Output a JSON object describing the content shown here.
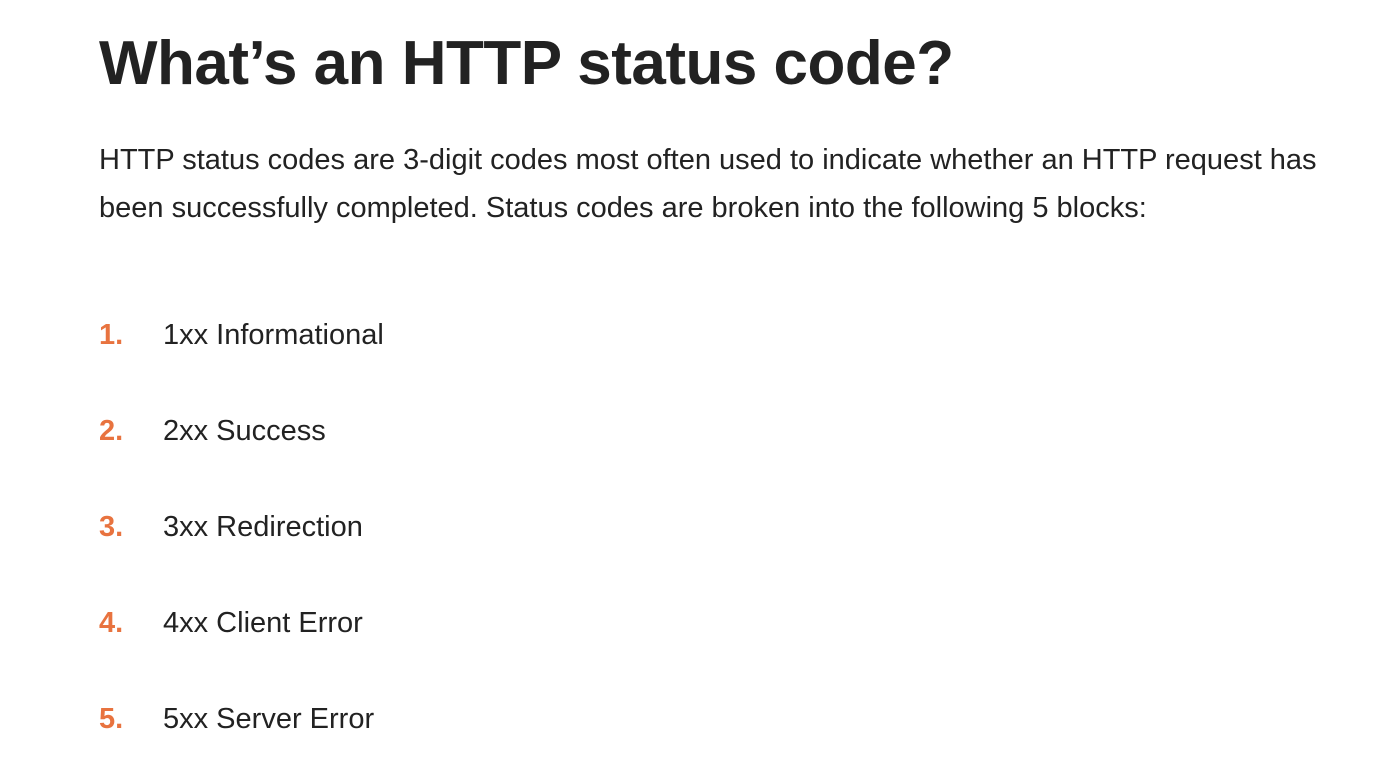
{
  "article": {
    "title": "What’s an HTTP status code?",
    "intro": "HTTP status codes are 3-digit codes most often used to indicate whether an HTTP request has been successfully completed. Status codes are broken into the following 5 blocks:",
    "accent_color": "#e8733f",
    "status_blocks": [
      {
        "number": "1.",
        "label": "1xx Informational"
      },
      {
        "number": "2.",
        "label": "2xx Success"
      },
      {
        "number": "3.",
        "label": "3xx Redirection"
      },
      {
        "number": "4.",
        "label": "4xx Client Error"
      },
      {
        "number": "5.",
        "label": "5xx Server Error"
      }
    ]
  }
}
